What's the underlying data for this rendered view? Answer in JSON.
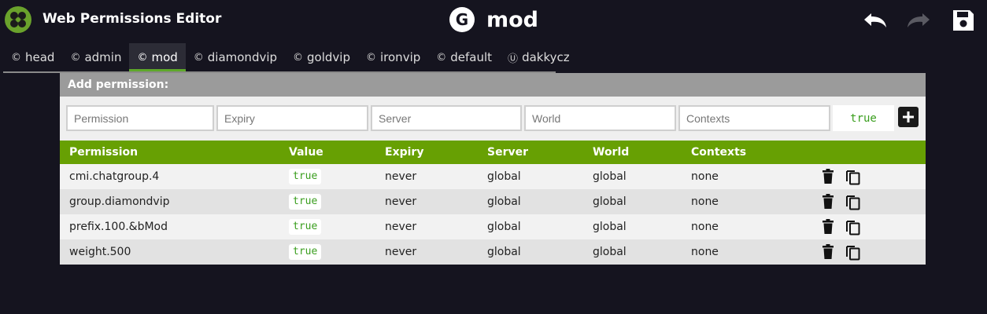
{
  "header": {
    "app_title": "Web Permissions Editor",
    "group_badge": "G",
    "group_name": "mod"
  },
  "tabs": [
    {
      "label": "head",
      "icon": "copyright-icon"
    },
    {
      "label": "admin",
      "icon": "copyright-icon"
    },
    {
      "label": "mod",
      "icon": "copyright-icon",
      "active": true
    },
    {
      "label": "diamondvip",
      "icon": "copyright-icon"
    },
    {
      "label": "goldvip",
      "icon": "copyright-icon"
    },
    {
      "label": "ironvip",
      "icon": "copyright-icon"
    },
    {
      "label": "default",
      "icon": "copyright-icon"
    },
    {
      "label": "dakkycz",
      "icon": "user-icon"
    }
  ],
  "add_permission": {
    "title": "Add permission:",
    "permission_placeholder": "Permission",
    "expiry_placeholder": "Expiry",
    "server_placeholder": "Server",
    "world_placeholder": "World",
    "contexts_placeholder": "Contexts",
    "value": "true"
  },
  "table": {
    "columns": [
      "Permission",
      "Value",
      "Expiry",
      "Server",
      "World",
      "Contexts"
    ],
    "rows": [
      {
        "permission": "cmi.chatgroup.4",
        "value": "true",
        "expiry": "never",
        "server": "global",
        "world": "global",
        "contexts": "none"
      },
      {
        "permission": "group.diamondvip",
        "value": "true",
        "expiry": "never",
        "server": "global",
        "world": "global",
        "contexts": "none"
      },
      {
        "permission": "prefix.100.&bMod",
        "value": "true",
        "expiry": "never",
        "server": "global",
        "world": "global",
        "contexts": "none"
      },
      {
        "permission": "weight.500",
        "value": "true",
        "expiry": "never",
        "server": "global",
        "world": "global",
        "contexts": "none"
      }
    ]
  },
  "colors": {
    "background": "#15141f",
    "accent": "#67a003",
    "value_text": "#3a9e1e"
  }
}
